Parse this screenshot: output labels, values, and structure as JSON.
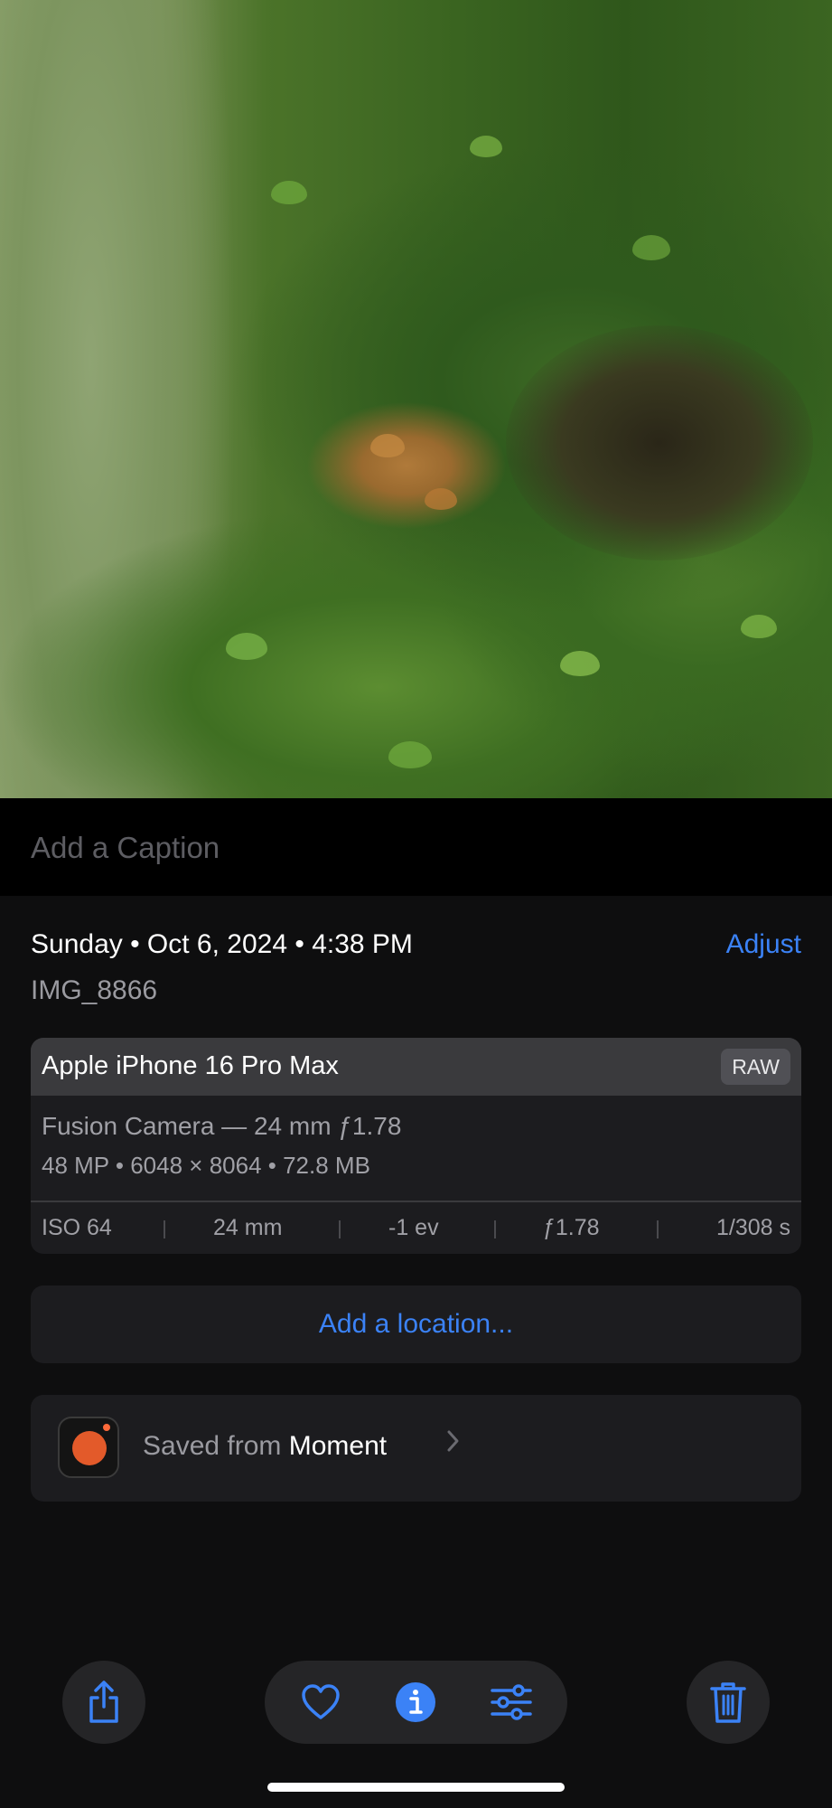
{
  "caption": {
    "placeholder": "Add a Caption"
  },
  "info": {
    "date_line": "Sunday • Oct 6, 2024 • 4:38 PM",
    "adjust_label": "Adjust",
    "filename": "IMG_8866"
  },
  "camera": {
    "model": "Apple iPhone 16 Pro Max",
    "format_badge": "RAW",
    "lens": "Fusion Camera — 24 mm ƒ1.78",
    "specs": "48 MP • 6048 × 8064 • 72.8 MB",
    "exif": {
      "iso": "ISO 64",
      "focal_length": "24 mm",
      "exposure": "-1 ev",
      "aperture": "ƒ1.78",
      "shutter": "1/308 s"
    }
  },
  "location": {
    "label": "Add a location..."
  },
  "saved_from": {
    "prefix": "Saved from",
    "app_name": "Moment"
  },
  "toolbar": {
    "icons": [
      "share-icon",
      "heart-icon",
      "info-icon",
      "adjust-sliders-icon",
      "trash-icon"
    ],
    "accent_color": "#3b82f6"
  }
}
